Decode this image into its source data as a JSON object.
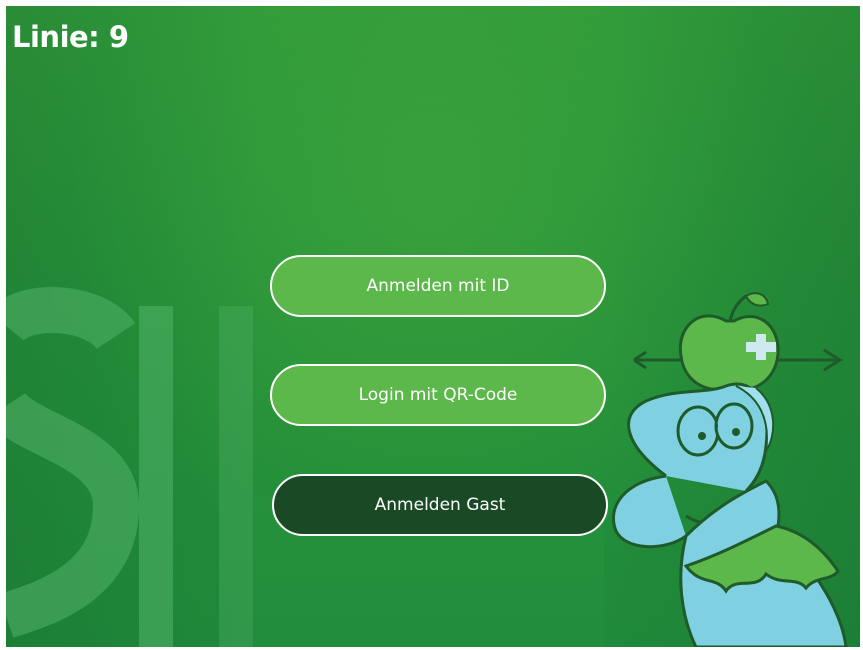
{
  "header": {
    "line_label": "Linie: 9"
  },
  "buttons": {
    "login_id": "Anmelden mit ID",
    "login_qr": "Login mit QR-Code",
    "login_guest": "Anmelden Gast"
  },
  "background": {
    "letters": "SIL"
  },
  "colors": {
    "background_green": "#25913a",
    "button_light": "#5cb84a",
    "button_dark": "#1a4a25",
    "text": "#ffffff"
  },
  "icons": {
    "mascot": "worm-with-apple-mascot"
  }
}
